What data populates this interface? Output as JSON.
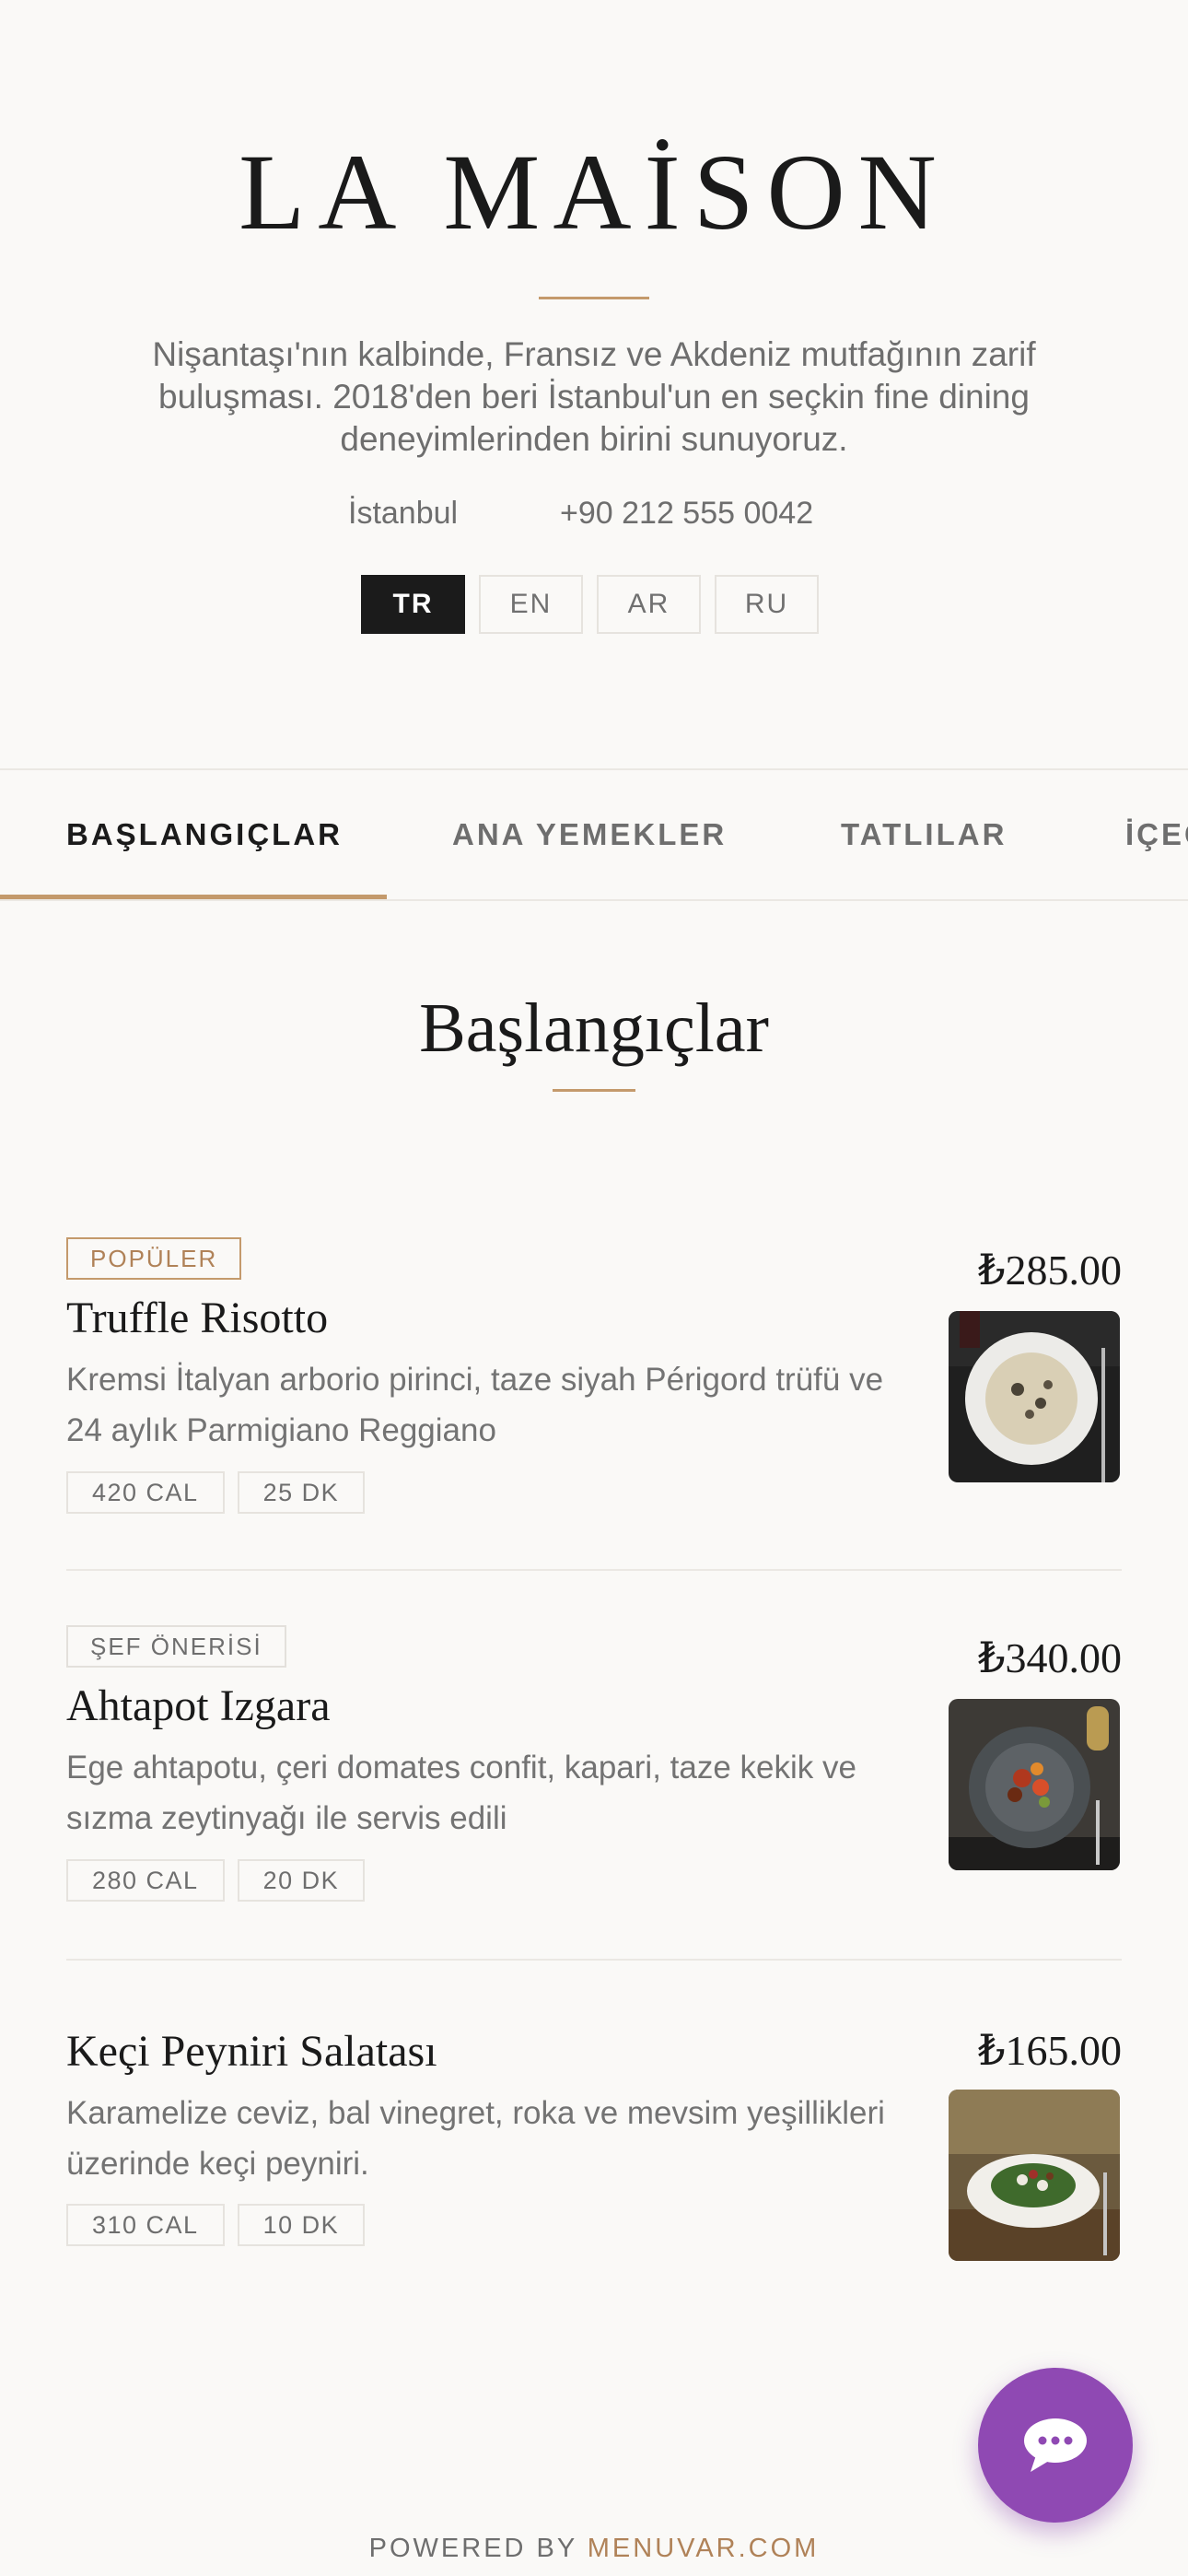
{
  "header": {
    "brand": "LA MAİSON",
    "tagline": "Nişantaşı'nın kalbinde, Fransız ve Akdeniz mutfağının zarif buluşması. 2018'den beri İstanbul'un en seçkin fine dining deneyimlerinden birini sunuyoruz.",
    "city": "İstanbul",
    "phone": "+90 212 555 0042",
    "languages": [
      "TR",
      "EN",
      "AR",
      "RU"
    ],
    "active_language": "TR"
  },
  "tabs": [
    "BAŞLANGIÇLAR",
    "ANA YEMEKLER",
    "TATLILAR",
    "İÇECEKLER"
  ],
  "active_tab": "BAŞLANGIÇLAR",
  "section": {
    "title": "Başlangıçlar"
  },
  "items": [
    {
      "badge": "POPÜLER",
      "name": "Truffle Risotto",
      "description": "Kremsi İtalyan arborio pirinci, taze siyah Périgord trüfü ve 24 aylık Parmigiano Reggiano",
      "calories": "420 CAL",
      "time": "25 DK",
      "price": "₺285.00"
    },
    {
      "badge": "ŞEF ÖNERİSİ",
      "name": "Ahtapot Izgara",
      "description": "Ege ahtapotu, çeri domates confit, kapari, taze kekik ve sızma zeytinyağı ile servis edili",
      "calories": "280 CAL",
      "time": "20 DK",
      "price": "₺340.00"
    },
    {
      "name": "Keçi Peyniri Salatası",
      "description": "Karamelize ceviz, bal vinegret, roka ve mevsim yeşillikleri üzerinde keçi peyniri.",
      "calories": "310 CAL",
      "time": "10 DK",
      "price": "₺165.00"
    }
  ],
  "footer": {
    "prefix": "POWERED BY",
    "brand": "MENUVAR.COM"
  },
  "colors": {
    "accent": "#c49a6c",
    "chat_button": "#8f49b3",
    "active_language_bg": "#1b1b1b"
  },
  "icons": {
    "chat_button": "chat-bubble-icon"
  }
}
